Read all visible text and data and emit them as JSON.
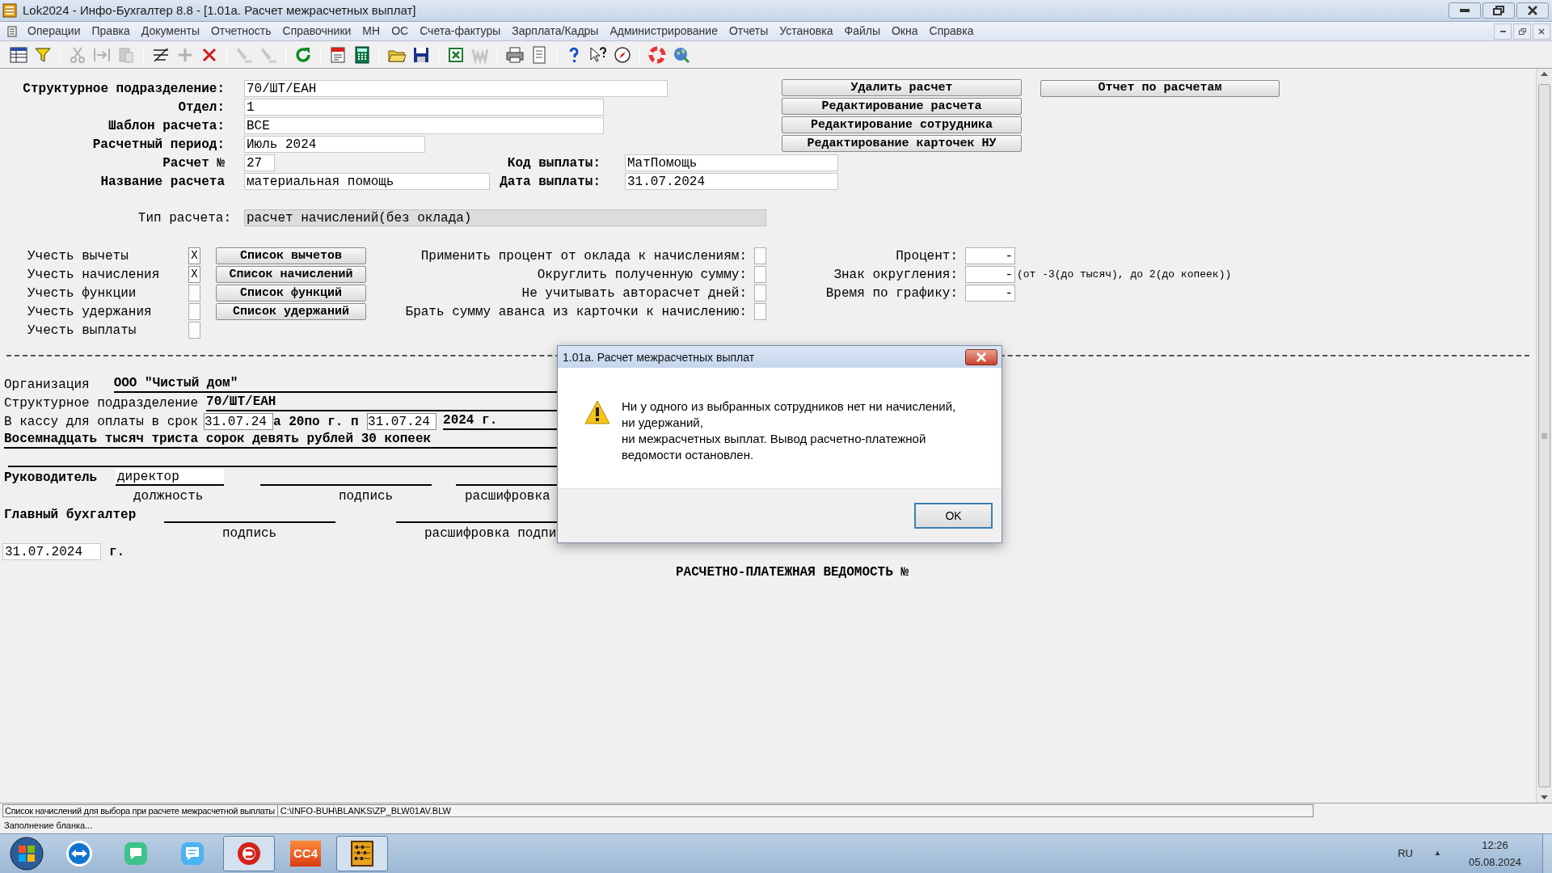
{
  "window": {
    "title": "Lok2024 - Инфо-Бухгалтер 8.8 - [1.01а. Расчет межрасчетных выплат]"
  },
  "menu": [
    "Операции",
    "Правка",
    "Документы",
    "Отчетность",
    "Справочники",
    "МН",
    "ОС",
    "Счета-фактуры",
    "Зарплата/Кадры",
    "Администрирование",
    "Отчеты",
    "Установка",
    "Файлы",
    "Окна",
    "Справка"
  ],
  "toolbar": [
    [
      {
        "kind": "grid",
        "disabled": false
      },
      {
        "kind": "filter",
        "disabled": false
      }
    ],
    [
      {
        "kind": "cut",
        "disabled": true
      },
      {
        "kind": "move",
        "disabled": true
      },
      {
        "kind": "paste",
        "disabled": true
      }
    ],
    [
      {
        "kind": "sort",
        "disabled": false
      },
      {
        "kind": "plus",
        "disabled": true
      },
      {
        "kind": "delete",
        "disabled": false
      }
    ],
    [
      {
        "kind": "pen",
        "disabled": true
      },
      {
        "kind": "pen",
        "disabled": true
      }
    ],
    [
      {
        "kind": "refresh",
        "disabled": false
      }
    ],
    [
      {
        "kind": "calendar",
        "disabled": false
      },
      {
        "kind": "calculator",
        "disabled": false
      }
    ],
    [
      {
        "kind": "folder",
        "disabled": false
      },
      {
        "kind": "save",
        "disabled": false
      }
    ],
    [
      {
        "kind": "sheet",
        "disabled": false
      },
      {
        "kind": "doc",
        "disabled": true
      }
    ],
    [
      {
        "kind": "printer",
        "disabled": false
      },
      {
        "kind": "page",
        "disabled": false
      }
    ],
    [
      {
        "kind": "help",
        "disabled": false
      },
      {
        "kind": "pointer",
        "disabled": false
      },
      {
        "kind": "compass",
        "disabled": false
      }
    ],
    [
      {
        "kind": "lifebuoy",
        "disabled": false
      },
      {
        "kind": "globe",
        "disabled": false
      }
    ]
  ],
  "form": {
    "fields": [
      {
        "label": "Структурное подразделение:",
        "value": "70/ШТ/ЕАН"
      },
      {
        "label": "Отдел:",
        "value": "1"
      },
      {
        "label": "Шаблон расчета:",
        "value": "ВСЕ"
      },
      {
        "label": "Расчетный период:",
        "value": "Июль 2024"
      },
      {
        "label": "Расчет №",
        "value": "27"
      },
      {
        "label": "Название расчета",
        "value": "материальная помощь"
      }
    ],
    "payment_code": {
      "label": "Код выплаты:",
      "value": "МатПомощь"
    },
    "payment_date": {
      "label": "Дата выплаты:",
      "value": "31.07.2024"
    },
    "action_buttons": [
      "Удалить расчет",
      "Редактирование расчета",
      "Редактирование сотрудника",
      "Редактирование карточек НУ"
    ],
    "report_button": "Отчет по расчетам",
    "calc_type": {
      "label": "Тип расчета:",
      "value": "расчет начислений(без оклада)"
    },
    "include_options": [
      {
        "label": "Учесть вычеты",
        "checked": true,
        "mark": "X",
        "button": "Список вычетов"
      },
      {
        "label": "Учесть начисления",
        "checked": true,
        "mark": "X",
        "button": "Список начислений"
      },
      {
        "label": "Учесть функции",
        "checked": false,
        "button": "Список функций"
      },
      {
        "label": "Учесть удержания",
        "checked": false,
        "button": "Список удержаний"
      },
      {
        "label": "Учесть выплаты",
        "checked": false
      }
    ],
    "options": [
      {
        "label": "Применить процент от оклада к начислениям:",
        "checked": false
      },
      {
        "label": "Округлить полученную сумму:",
        "checked": false
      },
      {
        "label": "Не учитывать авторасчет дней:",
        "checked": false
      },
      {
        "label": "Брать сумму аванса из карточки к начислению:",
        "checked": false
      }
    ],
    "params": [
      {
        "label": "Процент:",
        "value": "-"
      },
      {
        "label": "Знак округления:",
        "value": "-",
        "note": "(от -3(до тысяч), до 2(до копеек))"
      },
      {
        "label": "Время по графику:",
        "value": "-"
      }
    ]
  },
  "statement": {
    "org_label": "Организация",
    "org_value": "ООО \"Чистый дом\"",
    "unit_label": "Структурное подразделение",
    "unit_value": "70/ШТ/ЕАН",
    "term_label": "В кассу для оплаты в срок",
    "term_from": "31.07.24",
    "term_middle": "а 20по г. п",
    "term_to": "31.07.24",
    "term_year": "2024 г.",
    "amount_words": "Восемнадцать тысяч триста сорок девять рублей 30 копеек",
    "head_label": "Руководитель",
    "head_position": "директор",
    "head_captions": [
      "должность",
      "подпись",
      "расшифровка"
    ],
    "accountant_label": "Главный бухгалтер",
    "accountant_captions": [
      "подпись",
      "расшифровка подпи"
    ],
    "date": "31.07.2024",
    "date_suffix": "г.",
    "title": "РАСЧЕТНО-ПЛАТЕЖНАЯ ВЕДОМОСТЬ №"
  },
  "dialog": {
    "title": "1.01а. Расчет межрасчетных выплат",
    "lines": [
      "Ни у одного из выбранных сотрудников нет ни начислений,",
      "ни удержаний,",
      "ни межрасчетных выплат. Вывод расчетно-платежной",
      "ведомости остановлен."
    ],
    "ok_button": "OK"
  },
  "status_bar": {
    "hint": "Список начислений для выбора при расчете межрасчетной выплаты",
    "path": "C:\\INFO-BUH\\BLANKS\\ZP_BLW01AV.BLW",
    "message": "Заполнение бланка..."
  },
  "taskbar": {
    "apps": [
      {
        "kind": "remote",
        "running": false
      },
      {
        "kind": "chat",
        "running": false
      },
      {
        "kind": "messenger",
        "running": false
      },
      {
        "kind": "circle",
        "running": true
      },
      {
        "kind": "tile",
        "running": false,
        "label": "CC4"
      },
      {
        "kind": "abacus",
        "running": true
      }
    ],
    "language": "RU",
    "tray_arrow": "▲",
    "time": "12:26",
    "date": "05.08.2024"
  }
}
